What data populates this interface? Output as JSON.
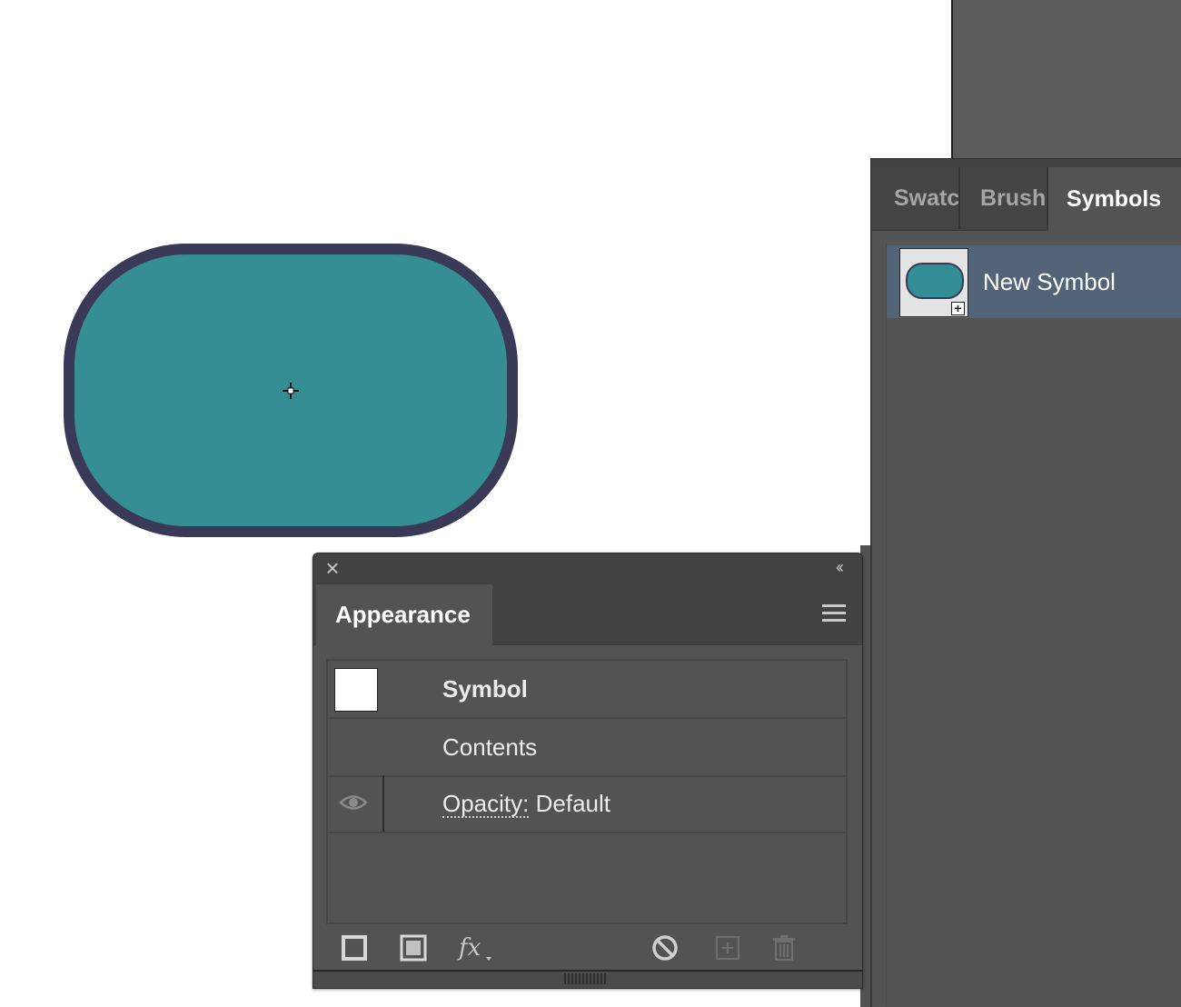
{
  "canvas": {
    "artwork": {
      "fill_color": "#348e94",
      "stroke_color": "#3a3a58",
      "cursor": "crosshair-icon"
    }
  },
  "symbols_panel": {
    "tabs": [
      {
        "label": "Swatc",
        "active": false
      },
      {
        "label": "Brush",
        "active": false
      },
      {
        "label": "Symbols",
        "active": true
      }
    ],
    "items": [
      {
        "name": "New Symbol",
        "selected": true
      }
    ],
    "selected_color": "#536479"
  },
  "appearance_panel": {
    "tab_label": "Appearance",
    "rows": [
      {
        "label": "Symbol"
      },
      {
        "label": "Contents"
      },
      {
        "label_link": "Opacity:",
        "value": "Default"
      }
    ],
    "toolbar_icons": [
      "add-new-stroke-icon",
      "add-new-fill-icon",
      "fx-icon",
      "clear-appearance-icon",
      "duplicate-item-icon",
      "delete-item-icon"
    ]
  }
}
